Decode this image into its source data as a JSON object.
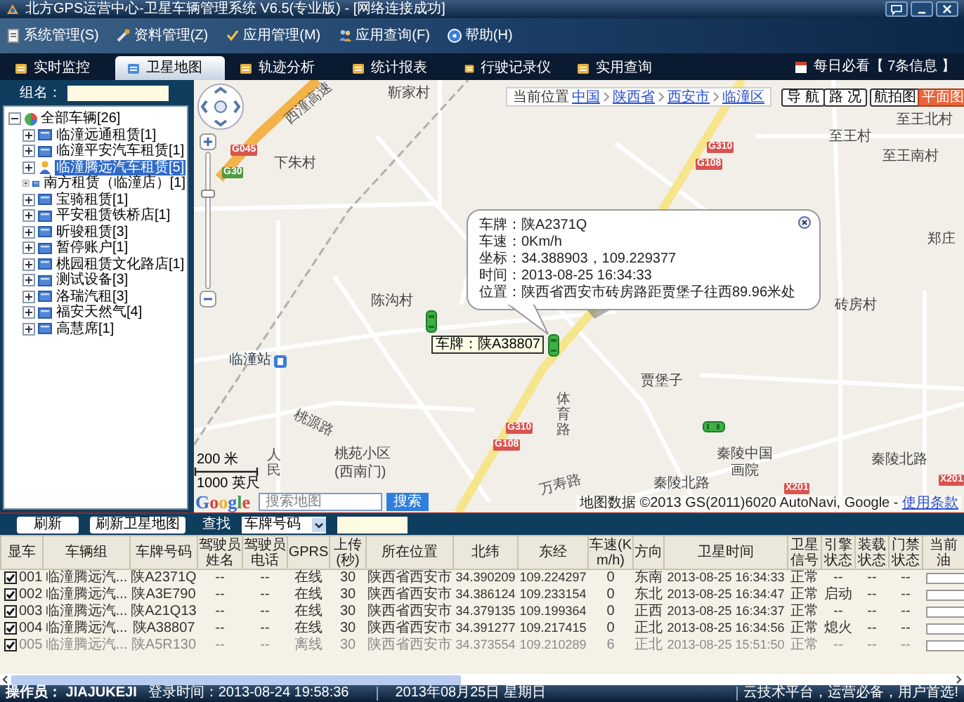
{
  "window": {
    "title": "北方GPS运营中心-卫星车辆管理系统 V6.5(专业版) - [网络连接成功]"
  },
  "menu": [
    "系统管理(S)",
    "资料管理(Z)",
    "应用管理(M)",
    "应用查询(F)",
    "帮助(H)"
  ],
  "tabs": [
    {
      "label": "实时监控",
      "selected": false
    },
    {
      "label": "卫星地图",
      "selected": true
    },
    {
      "label": "轨迹分析",
      "selected": false
    },
    {
      "label": "统计报表",
      "selected": false
    },
    {
      "label": "行驶记录仪",
      "selected": false
    },
    {
      "label": "实用查询",
      "selected": false
    }
  ],
  "notice": "每日必看【 7条信息 】",
  "sidebar": {
    "group_label": "组名：",
    "tree": {
      "label": "全部车辆[26]",
      "expanded": true,
      "children": [
        {
          "label": "临潼远通租赁[1]",
          "expanded": false,
          "selected": false
        },
        {
          "label": "临潼平安汽车租赁[1]",
          "expanded": false,
          "selected": false
        },
        {
          "label": "临潼腾远汽车租赁[5]",
          "expanded": false,
          "selected": true
        },
        {
          "label": "南方租赁（临潼店）[1]",
          "expanded": false,
          "selected": false
        },
        {
          "label": "宝骑租赁[1]",
          "expanded": false,
          "selected": false
        },
        {
          "label": "平安租赁铁桥店[1]",
          "expanded": false,
          "selected": false
        },
        {
          "label": "昕骏租赁[3]",
          "expanded": false,
          "selected": false
        },
        {
          "label": "暂停账户[1]",
          "expanded": false,
          "selected": false
        },
        {
          "label": "桃园租赁文化路店[1]",
          "expanded": false,
          "selected": false
        },
        {
          "label": "测试设备[3]",
          "expanded": false,
          "selected": false
        },
        {
          "label": "洛瑞汽租[3]",
          "expanded": false,
          "selected": false
        },
        {
          "label": "福安天然气[4]",
          "expanded": false,
          "selected": false
        },
        {
          "label": "高慧席[1]",
          "expanded": false,
          "selected": false
        }
      ]
    }
  },
  "map": {
    "breadcrumb": {
      "label": "当前位置",
      "items": [
        "中国",
        "陕西省",
        "西安市",
        "临潼区"
      ]
    },
    "traffic_buttons": [
      "导 航",
      "路 况"
    ],
    "view_buttons": [
      {
        "label": "航拍图",
        "selected": false
      },
      {
        "label": "平面图",
        "selected": true
      }
    ],
    "zoom_slider": {
      "level": 0.72
    },
    "labels": [
      {
        "text": "靳家村",
        "kind": "place"
      },
      {
        "text": "至王北村",
        "kind": "place"
      },
      {
        "text": "至王村",
        "kind": "place"
      },
      {
        "text": "下朱村",
        "kind": "place"
      },
      {
        "text": "至王南村",
        "kind": "place"
      },
      {
        "text": "郑庄",
        "kind": "place"
      },
      {
        "text": "陈沟村",
        "kind": "place"
      },
      {
        "text": "砖房村",
        "kind": "place"
      },
      {
        "text": "临潼站",
        "kind": "station"
      },
      {
        "text": "贾堡子",
        "kind": "place"
      },
      {
        "text": "体育路",
        "kind": "vertical"
      },
      {
        "text": "桃源路",
        "kind": "road"
      },
      {
        "text": "人民",
        "kind": "vertical"
      },
      {
        "text": "桃苑小区",
        "kind": "place"
      },
      {
        "text": "(西南门)",
        "kind": "place"
      },
      {
        "text": "万寿路",
        "kind": "road"
      },
      {
        "text": "秦陵北路",
        "kind": "place"
      },
      {
        "text": "秦陵北路",
        "kind": "place"
      },
      {
        "text": "秦陵中国",
        "kind": "place"
      },
      {
        "text": "画院",
        "kind": "place"
      },
      {
        "text": "西潼高速",
        "kind": "road"
      }
    ],
    "road_signs": [
      {
        "text": "G045",
        "color": "#d9534f"
      },
      {
        "text": "G30",
        "color": "#4f9a3c"
      },
      {
        "text": "G310",
        "color": "#d9534f"
      },
      {
        "text": "G108",
        "color": "#d9534f"
      },
      {
        "text": "G310",
        "color": "#d9534f"
      },
      {
        "text": "G108",
        "color": "#d9534f"
      },
      {
        "text": "X201",
        "color": "#d9534f"
      },
      {
        "text": "X201",
        "color": "#d9534f"
      }
    ],
    "popup": {
      "lines": [
        "车牌：陕A2371Q",
        "车速：0Km/h",
        "坐标：34.388903，109.229377",
        "时间：2013-08-25 16:34:33",
        "位置：陕西省西安市砖房路距贾堡子往西89.96米处"
      ]
    },
    "car_label": "车牌：陕A38807",
    "scale": [
      "200 米",
      "1000 英尺"
    ],
    "logo": "Google",
    "search": {
      "placeholder": "搜索地图",
      "button": "搜索"
    },
    "copyright": "地图数据 ©2013 GS(2011)6020 AutoNavi, Google - ",
    "terms_link": "使用条款"
  },
  "toolbar": {
    "refresh": "刷新",
    "refresh_map": "刷新卫星地图",
    "find_label": "查找",
    "find_select": "车牌号码"
  },
  "table": {
    "columns": [
      "显车",
      "车辆组",
      "车牌号码",
      "驾驶员姓名",
      "驾驶员电话",
      "GPRS",
      "上传(秒)",
      "所在位置",
      "北纬",
      "东经",
      "车速(Km/h)",
      "方向",
      "卫星时间",
      "卫星信号",
      "引擎状态",
      "装载状态",
      "门禁状态",
      "当前油"
    ],
    "rows": [
      {
        "checked": true,
        "offline": false,
        "cells": [
          "001",
          "临潼腾远汽...",
          "陕A2371Q",
          "--",
          "--",
          "在线",
          "30",
          "陕西省西安市",
          "34.390209",
          "109.224297",
          "0",
          "东南",
          "2013-08-25 16:34:33",
          "正常",
          "--",
          "--",
          "--"
        ]
      },
      {
        "checked": true,
        "offline": false,
        "cells": [
          "002",
          "临潼腾远汽...",
          "陕A3E790",
          "--",
          "--",
          "在线",
          "30",
          "陕西省西安市",
          "34.386124",
          "109.233154",
          "0",
          "东北",
          "2013-08-25 16:34:47",
          "正常",
          "启动",
          "--",
          "--"
        ]
      },
      {
        "checked": true,
        "offline": false,
        "cells": [
          "003",
          "临潼腾远汽...",
          "陕A21Q13",
          "--",
          "--",
          "在线",
          "30",
          "陕西省西安市",
          "34.379135",
          "109.199364",
          "0",
          "正西",
          "2013-08-25 16:34:37",
          "正常",
          "--",
          "--",
          "--"
        ]
      },
      {
        "checked": true,
        "offline": false,
        "cells": [
          "004",
          "临潼腾远汽...",
          "陕A38807",
          "--",
          "--",
          "在线",
          "30",
          "陕西省西安市",
          "34.391277",
          "109.217415",
          "0",
          "正北",
          "2013-08-25 16:34:56",
          "正常",
          "熄火",
          "--",
          "--"
        ]
      },
      {
        "checked": true,
        "offline": true,
        "cells": [
          "005",
          "临潼腾远汽...",
          "陕A5R130",
          "--",
          "--",
          "离线",
          "30",
          "陕西省西安市",
          "34.373554",
          "109.210289",
          "6",
          "正北",
          "2013-08-25 15:51:50",
          "正常",
          "--",
          "--",
          "--"
        ]
      }
    ]
  },
  "status_bar": {
    "operator": "操作员： JIAJUKEJI",
    "login": "登录时间：2013-08-24 19:58:36",
    "date": "2013年08月25日 星期日",
    "slogan": "云技术平台，运营必备，用户首选!"
  }
}
